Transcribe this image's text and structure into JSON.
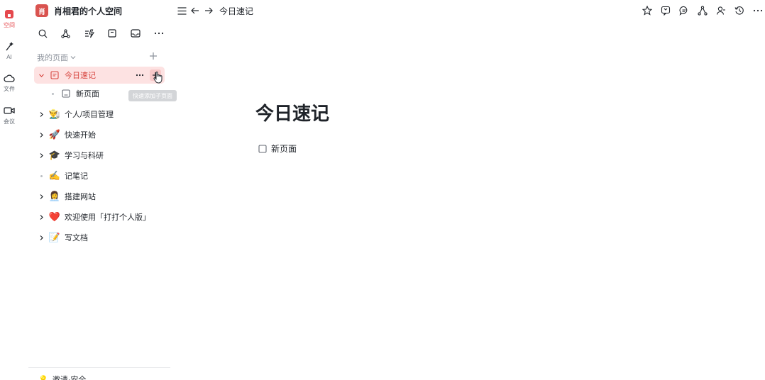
{
  "rail": {
    "items": [
      {
        "label": "空间",
        "icon": "home-icon",
        "active": true
      },
      {
        "label": "AI",
        "icon": "magic-wand-icon",
        "active": false
      },
      {
        "label": "文件",
        "icon": "cloud-icon",
        "active": false
      },
      {
        "label": "会议",
        "icon": "video-icon",
        "active": false
      }
    ]
  },
  "space": {
    "avatar_text": "肖",
    "name": "肖相君的个人空间"
  },
  "toolbar": {
    "icons": [
      "search-icon",
      "graph-icon",
      "shortcut-icon",
      "template-icon",
      "inbox-icon",
      "more-icon"
    ]
  },
  "section": {
    "label": "我的页面"
  },
  "tree": {
    "items": [
      {
        "label": "今日速记",
        "emoji": "",
        "expandable": true,
        "expanded": true,
        "selected": true
      },
      {
        "label": "新页面",
        "emoji": "",
        "expandable": false,
        "child": true
      },
      {
        "label": "个人/项目管理",
        "emoji": "👨‍🌾",
        "expandable": true
      },
      {
        "label": "快速开始",
        "emoji": "🚀",
        "expandable": true
      },
      {
        "label": "学习与科研",
        "emoji": "🎓",
        "expandable": true
      },
      {
        "label": "记笔记",
        "emoji": "✍️",
        "expandable": false
      },
      {
        "label": "搭建网站",
        "emoji": "👩‍💼",
        "expandable": true
      },
      {
        "label": "欢迎使用「打打个人版」",
        "emoji": "❤️",
        "expandable": true
      },
      {
        "label": "写文档",
        "emoji": "📝",
        "expandable": true
      }
    ],
    "tooltip": "快速添加子页面"
  },
  "footer": {
    "label": "邀请·安全",
    "emoji": "💡"
  },
  "topbar": {
    "breadcrumb": "今日速记"
  },
  "doc": {
    "title": "今日速记",
    "links": [
      {
        "label": "新页面"
      }
    ]
  },
  "colors": {
    "accent": "#e5484d",
    "selected_bg": "#fde2e2"
  }
}
